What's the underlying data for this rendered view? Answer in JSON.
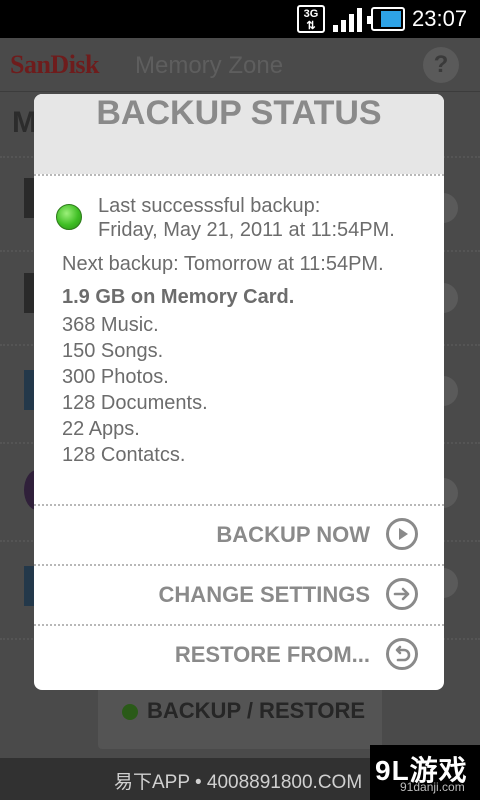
{
  "status_bar": {
    "network": "3G",
    "time": "23:07",
    "icons": [
      "3g-icon",
      "signal-icon",
      "battery-icon"
    ]
  },
  "app": {
    "brand": "SanDisk",
    "subtitle": "Memory Zone",
    "help_icon": "?",
    "page_title_partial": "M",
    "bottom_button": "BACKUP / RESTORE"
  },
  "dialog": {
    "title": "BACKUP STATUS",
    "status_color": "#3fbe24",
    "last_backup_label": "Last successsful backup:",
    "last_backup_date": "Friday, May 21, 2011 at 11:54PM.",
    "next_backup": "Next backup: Tomorrow at 11:54PM.",
    "storage_summary": "1.9 GB on Memory Card.",
    "items": [
      "368 Music.",
      "150 Songs.",
      "300 Photos.",
      "128 Documents.",
      "22 Apps.",
      "128 Contatcs."
    ],
    "actions": [
      {
        "label": "BACKUP NOW",
        "icon": "play-icon"
      },
      {
        "label": "CHANGE SETTINGS",
        "icon": "arrow-right-icon"
      },
      {
        "label": "RESTORE FROM...",
        "icon": "undo-icon"
      }
    ]
  },
  "watermark": {
    "text": "易下APP • 4008891800.COM",
    "logo": "9L游戏",
    "logo_sub": "91danji.com"
  }
}
